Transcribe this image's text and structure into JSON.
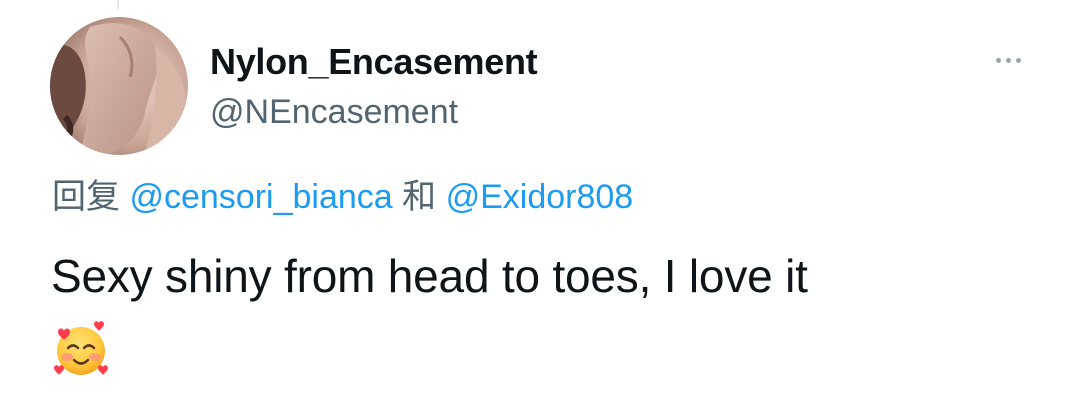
{
  "tweet": {
    "author": {
      "display_name": "Nylon_Encasement",
      "handle": "@NEncasement",
      "avatar_icon": "profile-photo"
    },
    "more_icon": "more-horizontal-icon",
    "reply": {
      "prefix": "回复",
      "mention_1": "@censori_bianca",
      "conjunction": "和",
      "mention_2": "@Exidor808"
    },
    "text": "Sexy shiny from head to toes, I love it",
    "emoji": "smiling-face-with-hearts",
    "colors": {
      "mention": "#1d9bf0",
      "secondary_text": "#536471",
      "primary_text": "#0f1419"
    }
  }
}
